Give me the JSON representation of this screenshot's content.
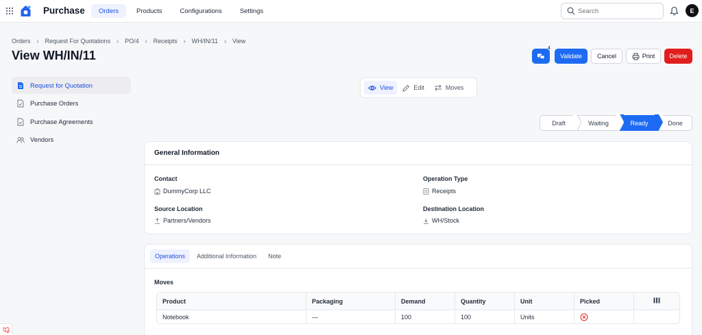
{
  "app": {
    "title": "Purchase",
    "nav": [
      {
        "label": "Orders",
        "active": true
      },
      {
        "label": "Products",
        "active": false
      },
      {
        "label": "Configurations",
        "active": false
      },
      {
        "label": "Settings",
        "active": false
      }
    ],
    "search_placeholder": "Search",
    "avatar_initial": "E",
    "accent_color": "#1d6bf3"
  },
  "breadcrumb": [
    "Orders",
    "Request For Quotations",
    "PO/4",
    "Receipts",
    "WH/IN/11",
    "View"
  ],
  "page_title": "View WH/IN/11",
  "actions": {
    "chat_badge": "4",
    "validate": "Validate",
    "cancel": "Cancel",
    "print": "Print",
    "delete": "Delete"
  },
  "sidebar": [
    {
      "label": "Request for Quotation",
      "icon": "document-icon",
      "active": true
    },
    {
      "label": "Purchase Orders",
      "icon": "document-check-icon",
      "active": false
    },
    {
      "label": "Purchase Agreements",
      "icon": "document-check-icon",
      "active": false
    },
    {
      "label": "Vendors",
      "icon": "users-icon",
      "active": false
    }
  ],
  "view_switch": [
    {
      "label": "View",
      "icon": "eye-icon",
      "active": true
    },
    {
      "label": "Edit",
      "icon": "pencil-icon",
      "active": false
    },
    {
      "label": "Moves",
      "icon": "arrows-icon",
      "active": false
    }
  ],
  "status_steps": [
    {
      "label": "Draft",
      "active": false
    },
    {
      "label": "Waiting",
      "active": false
    },
    {
      "label": "Ready",
      "active": true
    },
    {
      "label": "Done",
      "active": false
    }
  ],
  "general": {
    "heading": "General Information",
    "contact_label": "Contact",
    "contact_value": "DummyCorp LLC",
    "operation_type_label": "Operation Type",
    "operation_type_value": "Receipts",
    "source_location_label": "Source Location",
    "source_location_value": "Partners/Vendors",
    "destination_location_label": "Destination Location",
    "destination_location_value": "WH/Stock"
  },
  "tabs": [
    {
      "label": "Operations",
      "active": true
    },
    {
      "label": "Additional Information",
      "active": false
    },
    {
      "label": "Note",
      "active": false
    }
  ],
  "moves": {
    "heading": "Moves",
    "columns": [
      "Product",
      "Packaging",
      "Demand",
      "Quantity",
      "Unit",
      "Picked"
    ],
    "rows": [
      {
        "product": "Notebook",
        "packaging": "—",
        "demand": "100",
        "quantity": "100",
        "unit": "Units",
        "picked": false
      }
    ]
  }
}
